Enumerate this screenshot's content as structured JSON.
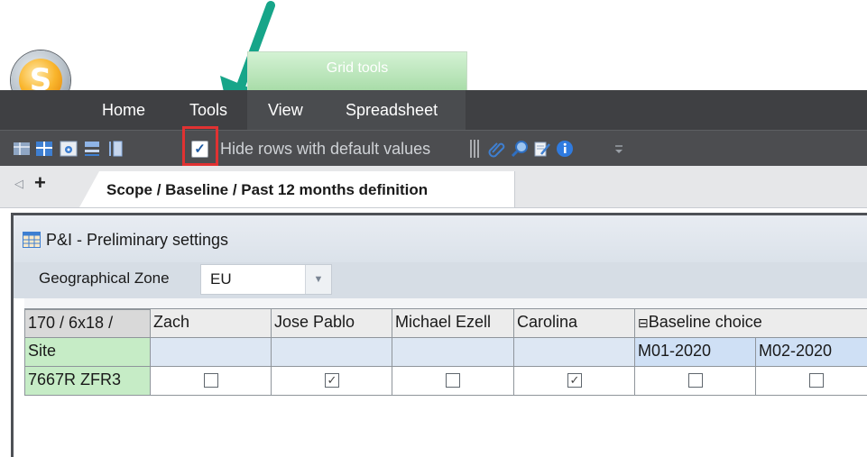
{
  "app": {
    "logo_letter": "S"
  },
  "ribbon": {
    "context_tab": "Grid tools",
    "tabs": [
      "Home",
      "Tools",
      "View",
      "Spreadsheet"
    ]
  },
  "toolbar": {
    "hide_rows_label": "Hide rows with default values",
    "hide_rows_checked": true
  },
  "doc_tabs": {
    "active_label": "Scope / Baseline / Past 12 months definition"
  },
  "panel": {
    "title": "P&I - Preliminary settings",
    "geo_label": "Geographical Zone",
    "geo_value": "EU"
  },
  "grid": {
    "corner": "170 / 6x18 /",
    "site_label": "Site",
    "row_key": "7667R ZFR3",
    "columns": [
      "Zach",
      "Jose Pablo",
      "Michael Ezell",
      "Carolina"
    ],
    "group_header": "Baseline choice",
    "group_expander": "⊟",
    "sub_columns": [
      "M01-2020",
      "M02-2020"
    ],
    "row_checks": [
      false,
      true,
      false,
      true,
      false,
      false
    ]
  },
  "colors": {
    "annotation_arrow": "#17a589",
    "highlight": "#e03232",
    "key_cell": "#c6ecc6",
    "sub_header": "#cfe0f5"
  }
}
